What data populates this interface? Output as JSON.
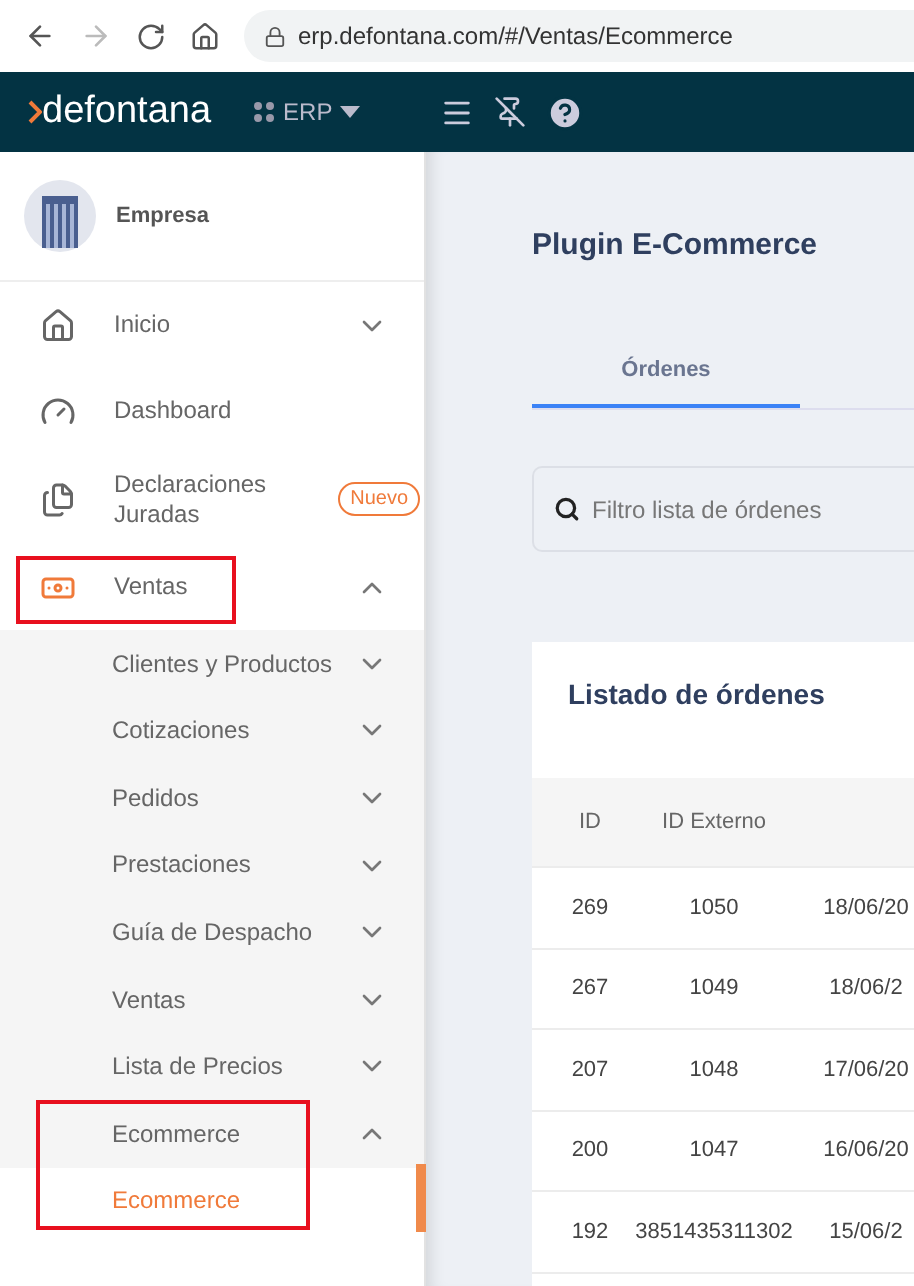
{
  "browser": {
    "url": "erp.defontana.com/#/Ventas/Ecommerce"
  },
  "header": {
    "logo": "defontana",
    "module": "ERP"
  },
  "sidebar": {
    "company": "Empresa",
    "items": [
      {
        "label": "Inicio",
        "kind": "group",
        "expanded": false,
        "highlighted": false
      },
      {
        "label": "Dashboard",
        "kind": "link",
        "highlighted": false
      },
      {
        "label": "Declaraciones Juradas",
        "kind": "link",
        "badge": "Nuevo",
        "highlighted": false
      },
      {
        "label": "Ventas",
        "kind": "group",
        "expanded": true,
        "highlighted": true,
        "children": [
          {
            "label": "Clientes y Productos",
            "expanded": false,
            "highlighted": false
          },
          {
            "label": "Cotizaciones",
            "expanded": false,
            "highlighted": false
          },
          {
            "label": "Pedidos",
            "expanded": false,
            "highlighted": false
          },
          {
            "label": "Prestaciones",
            "expanded": false,
            "highlighted": false
          },
          {
            "label": "Guía de Despacho",
            "expanded": false,
            "highlighted": false
          },
          {
            "label": "Ventas",
            "expanded": false,
            "highlighted": false
          },
          {
            "label": "Lista de Precios",
            "expanded": false,
            "highlighted": false
          },
          {
            "label": "Ecommerce",
            "expanded": true,
            "highlighted": true,
            "children": [
              {
                "label": "Ecommerce",
                "selected": true
              }
            ]
          }
        ]
      }
    ]
  },
  "main": {
    "title": "Plugin E-Commerce",
    "tabs": [
      {
        "label": "Órdenes",
        "selected": true
      }
    ],
    "search": {
      "placeholder": "Filtro lista de órdenes"
    },
    "table": {
      "title": "Listado de órdenes",
      "columns": [
        "ID",
        "ID Externo"
      ],
      "rows": [
        [
          "269",
          "1050",
          "18/06/20"
        ],
        [
          "267",
          "1049",
          "18/06/2"
        ],
        [
          "207",
          "1048",
          "17/06/20"
        ],
        [
          "200",
          "1047",
          "16/06/20"
        ],
        [
          "192",
          "3851435311302",
          "15/06/2"
        ]
      ]
    }
  }
}
